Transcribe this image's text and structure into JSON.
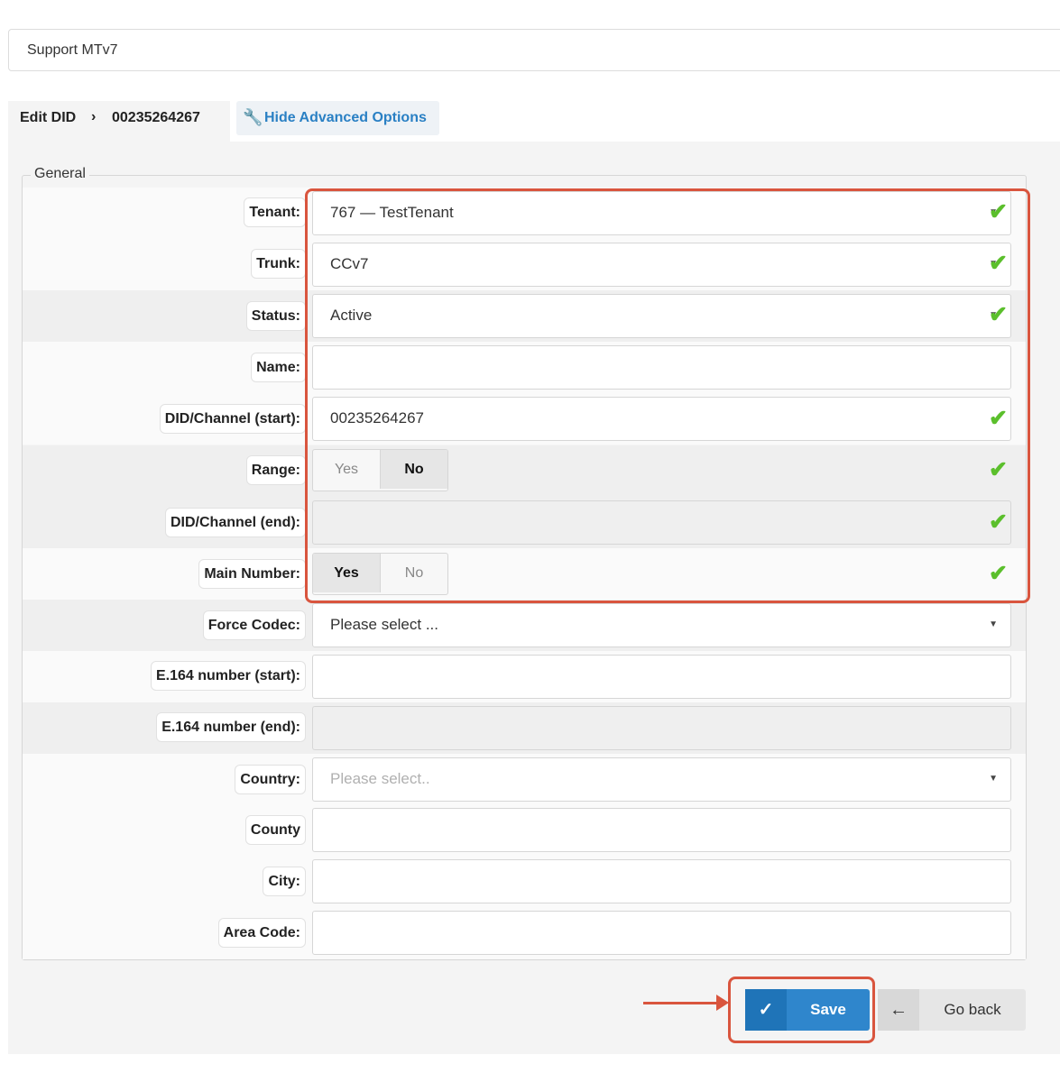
{
  "topbar": {
    "title": "Support MTv7"
  },
  "header": {
    "edit_label": "Edit DID",
    "separator": "›",
    "did_number": "00235264267",
    "advanced_link": "Hide Advanced Options",
    "advanced_icon": "wrench-icon"
  },
  "fieldset": {
    "legend": "General"
  },
  "fields": {
    "tenant": {
      "label": "Tenant:",
      "value": "767 — TestTenant"
    },
    "trunk": {
      "label": "Trunk:",
      "value": "CCv7"
    },
    "status": {
      "label": "Status:",
      "value": "Active"
    },
    "name": {
      "label": "Name:",
      "value": ""
    },
    "did_start": {
      "label": "DID/Channel (start):",
      "value": "00235264267"
    },
    "range": {
      "label": "Range:",
      "yes": "Yes",
      "no": "No",
      "selected": "No"
    },
    "did_end": {
      "label": "DID/Channel (end):",
      "value": ""
    },
    "main_number": {
      "label": "Main Number:",
      "yes": "Yes",
      "no": "No",
      "selected": "Yes"
    },
    "force_codec": {
      "label": "Force Codec:",
      "value": "Please select ..."
    },
    "e164_start": {
      "label": "E.164 number (start):",
      "value": ""
    },
    "e164_end": {
      "label": "E.164 number (end):",
      "value": ""
    },
    "country": {
      "label": "Country:",
      "placeholder": "Please select.."
    },
    "county": {
      "label": "County",
      "value": ""
    },
    "city": {
      "label": "City:",
      "value": ""
    },
    "area_code": {
      "label": "Area Code:",
      "value": ""
    }
  },
  "buttons": {
    "save": "Save",
    "go_back": "Go back"
  },
  "colors": {
    "accent": "#2f86cc",
    "valid": "#5bbf2c",
    "highlight": "#d9553e"
  }
}
